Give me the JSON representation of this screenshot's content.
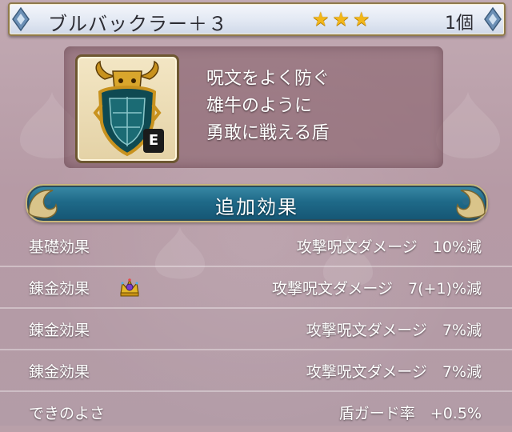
{
  "item": {
    "name": "ブルバックラー＋３",
    "star_count": 3,
    "stars": [
      "★",
      "★",
      "★"
    ],
    "quantity": "1個",
    "icon": "bull-buckler-shield-icon",
    "equipped_badge": "E",
    "description": [
      "呪文をよく防ぐ",
      "雄牛のように",
      "勇敢に戦える盾"
    ]
  },
  "section": {
    "title": "追加効果"
  },
  "effects": [
    {
      "label": "基礎効果",
      "value": "攻撃呪文ダメージ　10%減",
      "icon": ""
    },
    {
      "label": "錬金効果",
      "value": "攻撃呪文ダメージ　7(+1)%減",
      "icon": "crown-icon"
    },
    {
      "label": "錬金効果",
      "value": "攻撃呪文ダメージ　7%減",
      "icon": ""
    },
    {
      "label": "錬金効果",
      "value": "攻撃呪文ダメージ　7%減",
      "icon": ""
    },
    {
      "label": "できのよさ",
      "value": "盾ガード率　+0.5%",
      "icon": ""
    }
  ],
  "colors": {
    "background": "#b9a0a9",
    "star": "#f2b71a",
    "banner": "#1f6a89"
  }
}
